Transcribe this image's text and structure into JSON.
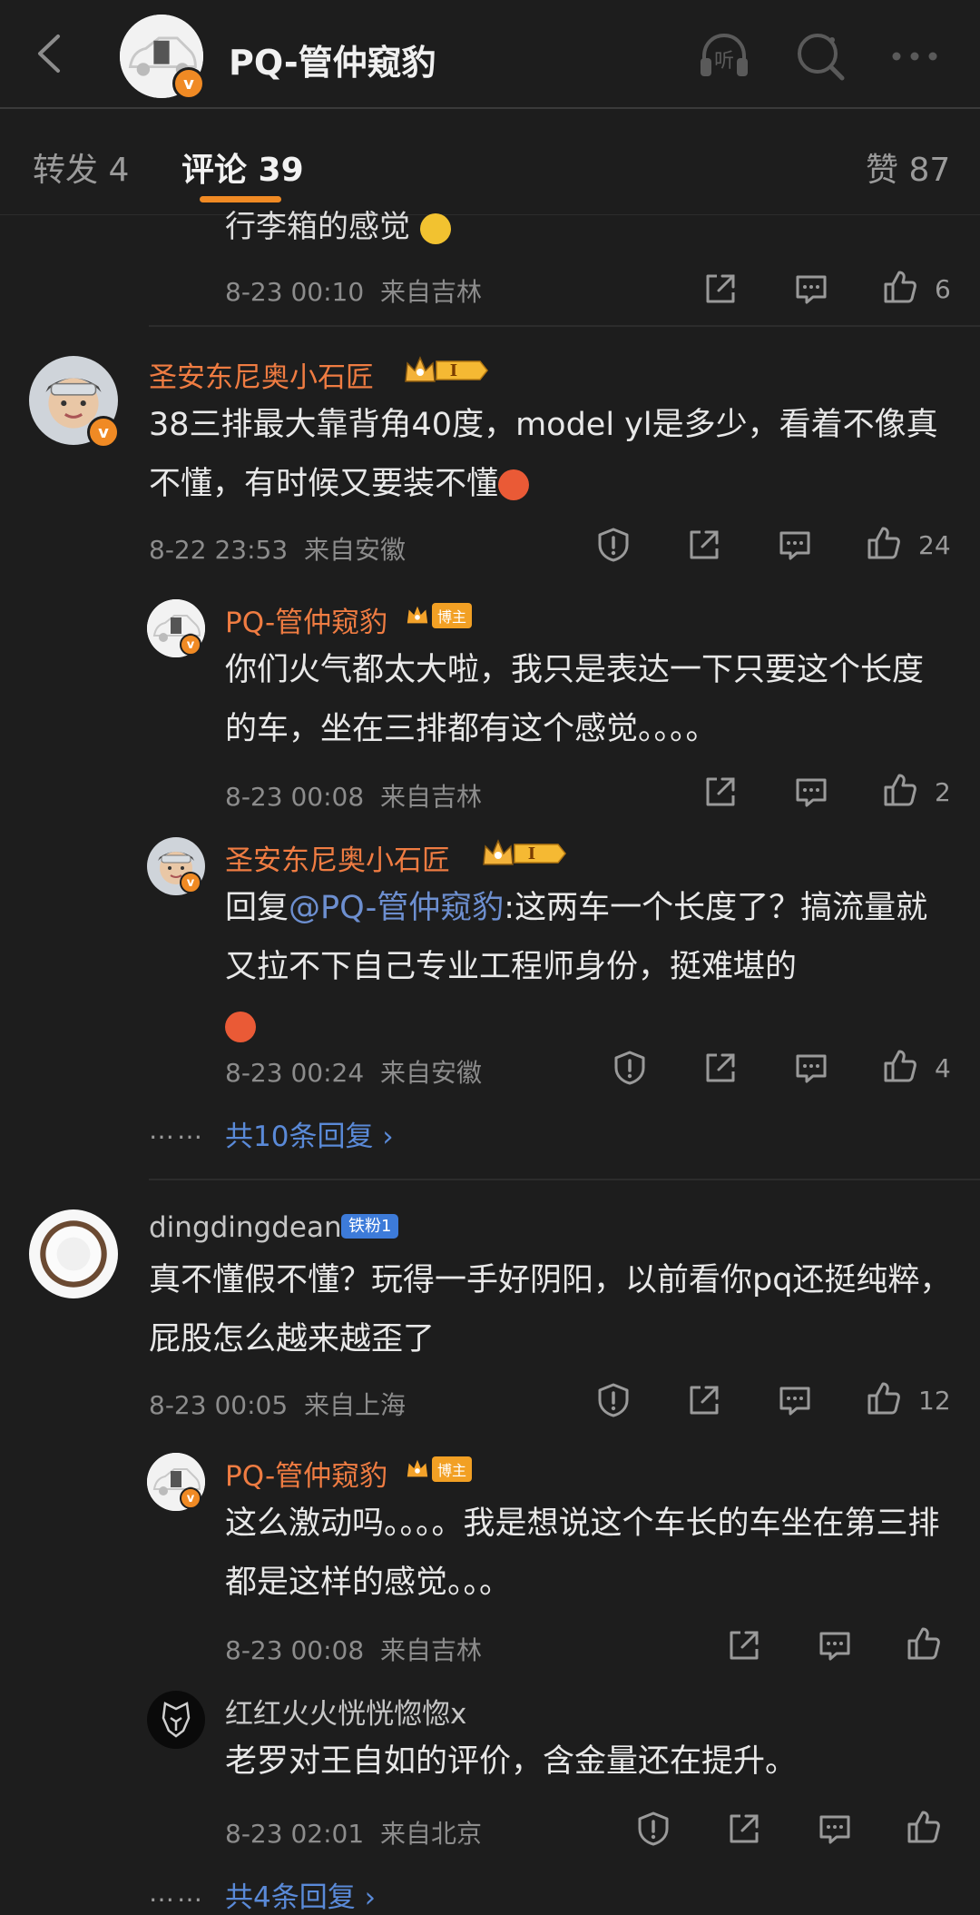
{
  "header": {
    "title": "PQ-管仲窥豹",
    "verified": "v",
    "listen_label": "听"
  },
  "tabs": {
    "repost": "转发 4",
    "comments": "评论 39",
    "likes": "赞 87"
  },
  "comments": [
    {
      "text_partial": "行李箱的感觉",
      "time": "8-23 00:10",
      "location": "来自吉林",
      "likes": "6"
    },
    {
      "user": "圣安东尼奥小石匠",
      "rank": "I",
      "text": "38三排最大靠背角40度，model yl是多少，看着不像真不懂，有时候又要装不懂",
      "time": "8-22 23:53",
      "location": "来自安徽",
      "likes": "24",
      "replies": [
        {
          "user": "PQ-管仲窥豹",
          "badge": "博主",
          "text": "你们火气都太大啦，我只是表达一下只要这个长度的车，坐在三排都有这个感觉。。。。",
          "time": "8-23 00:08",
          "location": "来自吉林",
          "likes": "2"
        },
        {
          "user": "圣安东尼奥小石匠",
          "rank": "I",
          "reply_prefix": "回复",
          "mention": "@PQ-管仲窥豹",
          "text": ":这两车一个长度了？搞流量就又拉不下自己专业工程师身份，挺难堪的",
          "time": "8-23 00:24",
          "location": "来自安徽",
          "likes": "4"
        }
      ],
      "more_replies": "共10条回复 ›",
      "ellipsis": "……"
    },
    {
      "user": "dingdingdean",
      "badge": "铁粉1",
      "text": "真不懂假不懂？玩得一手好阴阳，以前看你pq还挺纯粹，屁股怎么越来越歪了",
      "time": "8-23 00:05",
      "location": "来自上海",
      "likes": "12",
      "replies": [
        {
          "user": "PQ-管仲窥豹",
          "badge": "博主",
          "text": "这么激动吗。。。。我是想说这个车长的车坐在第三排都是这样的感觉。。。",
          "time": "8-23 00:08",
          "location": "来自吉林"
        },
        {
          "user": "红红火火恍恍惚惚x",
          "text": "老罗对王自如的评价，含金量还在提升。",
          "time": "8-23 02:01",
          "location": "来自北京"
        }
      ],
      "more_replies": "共4条回复 ›",
      "ellipsis": "……"
    }
  ],
  "colors": {
    "background": "#1d1d1d",
    "accent": "#f08a24",
    "username": "#ef7c42",
    "link": "#5a8ad8"
  }
}
